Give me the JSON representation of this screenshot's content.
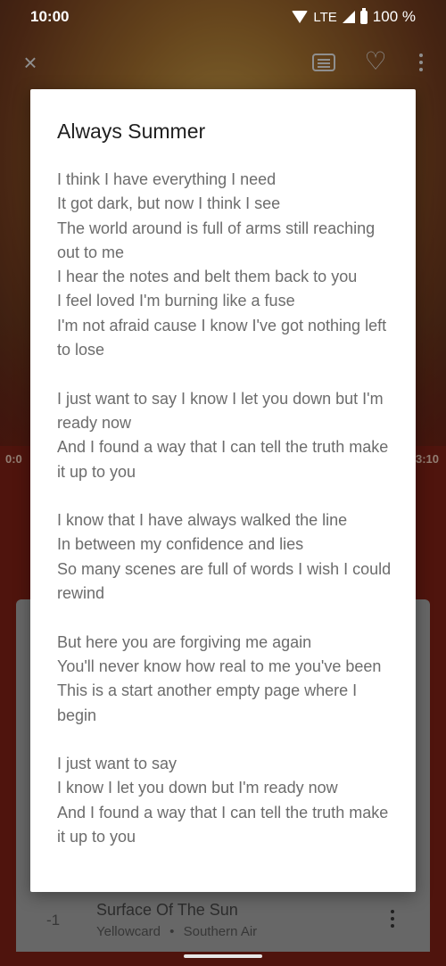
{
  "status_bar": {
    "time": "10:00",
    "network": "LTE",
    "battery": "100 %"
  },
  "toolbar": {
    "icons": [
      "close-icon",
      "lyrics-icon",
      "heart-icon",
      "more-vert-icon"
    ]
  },
  "player": {
    "elapsed": "0:0",
    "duration": "3:10"
  },
  "background_list": {
    "row": {
      "index": "-1",
      "title": "Surface Of The Sun",
      "artist": "Yellowcard",
      "separator": "•",
      "album": "Southern Air"
    }
  },
  "dialog": {
    "title": "Always Summer",
    "stanzas": [
      [
        "I think I have everything I need",
        "It got dark, but now I think I see",
        "The world around is full of arms still reaching out to me",
        "I hear the notes and belt them back to you",
        "I feel loved I'm burning like a fuse",
        "I'm not afraid cause I know I've got nothing left to lose"
      ],
      [
        "I just want to say I know I let you down but I'm ready now",
        "And I found a way that I can tell the truth make it up to you"
      ],
      [
        "I know that I have always walked the line",
        "In between my confidence and lies",
        "So many scenes are full of words I wish I could rewind"
      ],
      [
        "But here you are forgiving me again",
        "You'll never know how real to me you've been",
        "This is a start another empty page where I begin"
      ],
      [
        "I just want to say",
        "I know I let you down but I'm ready now",
        "And I found a way that I can tell the truth make it up to you"
      ]
    ]
  }
}
